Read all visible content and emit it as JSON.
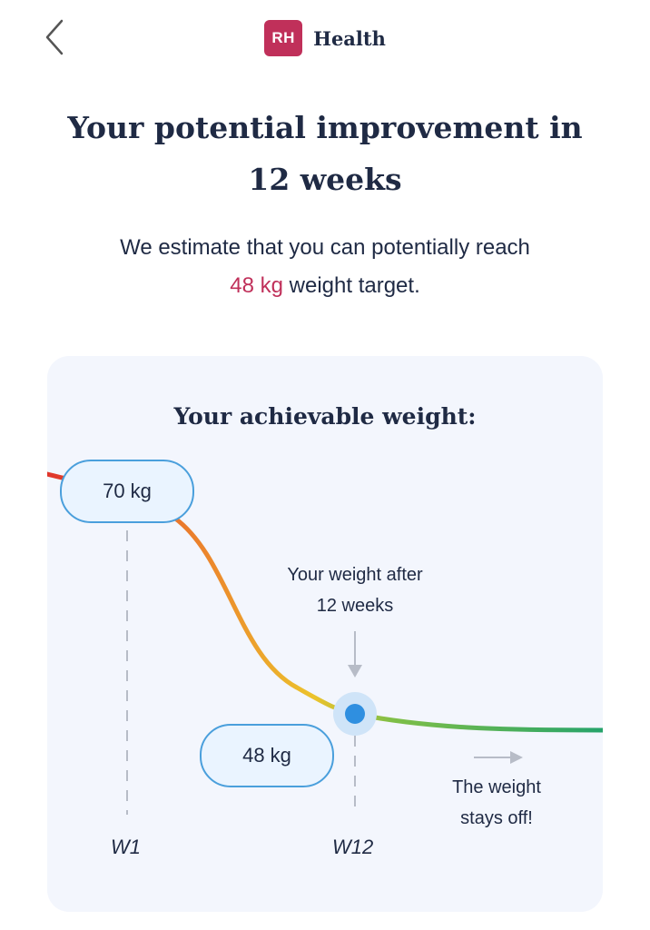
{
  "header": {
    "back_label": "Back",
    "brand_logo": "RH",
    "brand_name": "Health",
    "brand_color": "#c0305a"
  },
  "title": {
    "line1": "Your potential improvement in",
    "line2": "12 weeks"
  },
  "subtitle": {
    "line1": "We estimate that you can potentially reach",
    "highlight": "48 kg",
    "suffix": " weight target."
  },
  "chart_data": {
    "type": "line",
    "title": "Your achievable weight:",
    "x": [
      "W1",
      "W12"
    ],
    "start_value": 70,
    "end_value": 48,
    "unit": "kg",
    "start_label": "70 kg",
    "end_label": "48 kg",
    "tick_labels": [
      "W1",
      "W12"
    ],
    "annotation_after": [
      "Your weight after",
      "12 weeks"
    ],
    "annotation_off": [
      "The weight",
      "stays off!"
    ],
    "gradient_colors": [
      "#e0352b",
      "#ec8a2c",
      "#ecc32c",
      "#7fbf47",
      "#25a36a"
    ],
    "marker_color": "#2f8fe0"
  }
}
